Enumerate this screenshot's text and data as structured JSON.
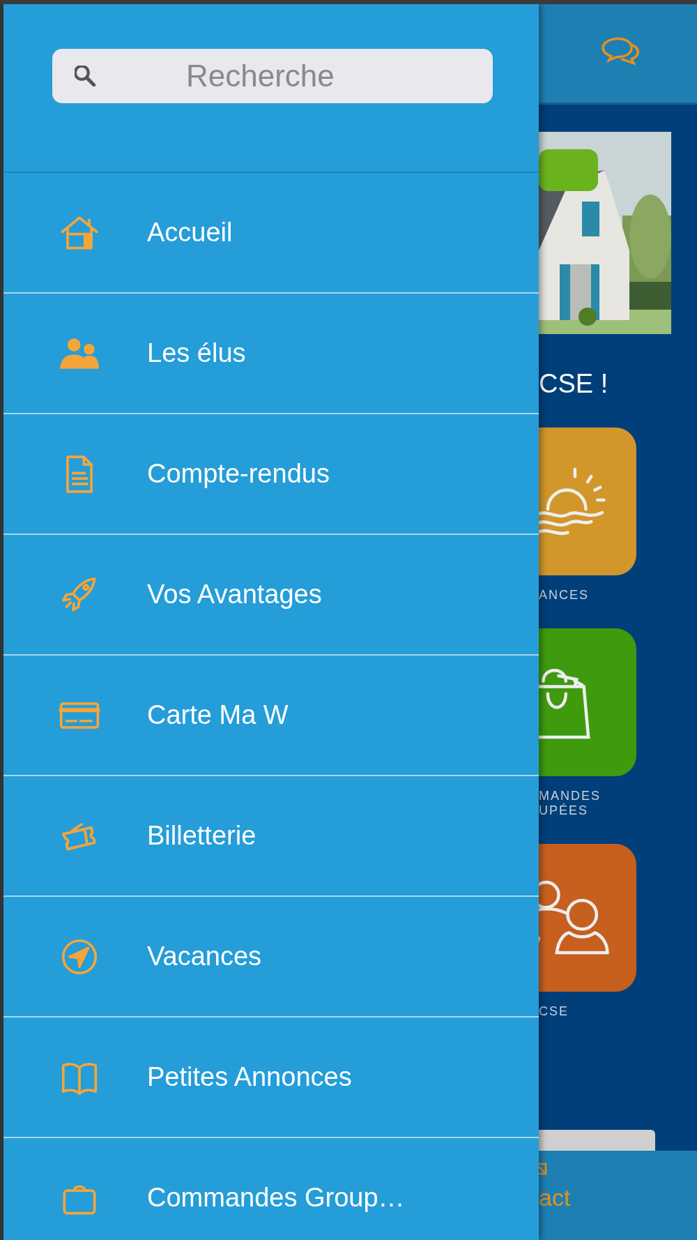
{
  "drawer": {
    "search": {
      "placeholder": "Recherche"
    },
    "items": [
      {
        "label": "Accueil",
        "kind": "home"
      },
      {
        "label": "Les élus",
        "kind": "people"
      },
      {
        "label": "Compte-rendus",
        "kind": "document"
      },
      {
        "label": "Vos Avantages",
        "kind": "rocket"
      },
      {
        "label": "Carte Ma W",
        "kind": "card"
      },
      {
        "label": "Billetterie",
        "kind": "ticket"
      },
      {
        "label": "Vacances",
        "kind": "compass"
      },
      {
        "label": "Petites Annonces",
        "kind": "book"
      },
      {
        "label": "Commandes Group…",
        "kind": "bag"
      }
    ]
  },
  "background": {
    "headline": "CSE !",
    "tiles": [
      {
        "kind": "sun",
        "color": "#d2962a",
        "label": [
          "ANCES"
        ]
      },
      {
        "kind": "shopping",
        "color": "#3f9a0e",
        "label": [
          "MANDES",
          "UPÉES"
        ]
      },
      {
        "kind": "group",
        "color": "#c75f1e",
        "label": [
          "CSE"
        ]
      }
    ],
    "bottom_tab": {
      "label": "act"
    }
  }
}
